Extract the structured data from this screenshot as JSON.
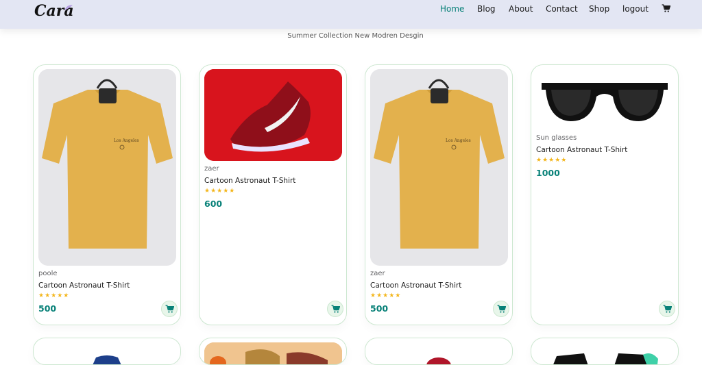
{
  "header": {
    "logo_text": "Cara",
    "nav": [
      {
        "label": "Home",
        "active": true
      },
      {
        "label": "Blog",
        "active": false
      },
      {
        "label": "About",
        "active": false
      },
      {
        "label": "Contact",
        "active": false
      },
      {
        "label": "Shop",
        "active": false
      },
      {
        "label": "logout",
        "active": false
      }
    ],
    "cart_icon": "cart-icon"
  },
  "subtitle": "Summer Collection New Modren Desgin",
  "products": [
    {
      "image": "yellow-tshirt",
      "brand": "poole",
      "name": "Cartoon Astronaut T-Shirt",
      "rating": 5,
      "stars": "★★★★★",
      "price": "500"
    },
    {
      "image": "red-sneaker",
      "brand": "zaer",
      "name": "Cartoon Astronaut T-Shirt",
      "rating": 5,
      "stars": "★★★★★",
      "price": "600"
    },
    {
      "image": "yellow-tshirt",
      "brand": "zaer",
      "name": "Cartoon Astronaut T-Shirt",
      "rating": 5,
      "stars": "★★★★★",
      "price": "500"
    },
    {
      "image": "sunglasses",
      "brand": "Sun glasses",
      "name": "Cartoon Astronaut T-Shirt",
      "rating": 5,
      "stars": "★★★★★",
      "price": "1000"
    }
  ],
  "next_row_images": [
    "blue-shirt",
    "shoes-mixed",
    "red-cap",
    "black-tshirt"
  ],
  "colors": {
    "accent": "#088178",
    "header_bg": "#e3e6f3",
    "star": "#f3b519",
    "card_border": "#cce7d0"
  }
}
